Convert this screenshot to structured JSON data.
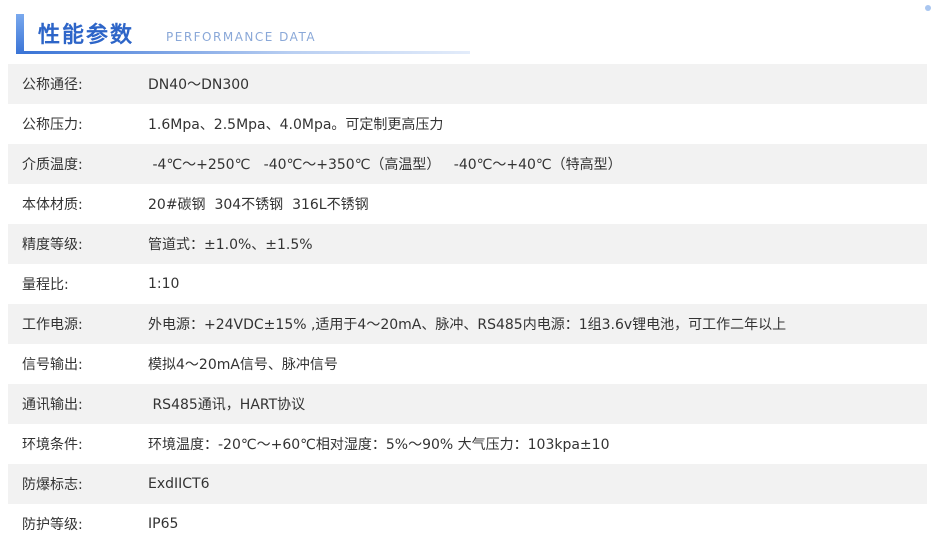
{
  "header": {
    "title": "性能参数",
    "subtitle": "PERFORMANCE DATA"
  },
  "rows": [
    {
      "label": "公称通径:",
      "value": "DN40～DN300"
    },
    {
      "label": "公称压力:",
      "value": "1.6Mpa、2.5Mpa、4.0Mpa。可定制更高压力"
    },
    {
      "label": "介质温度:",
      "value": " -4℃～+250℃   -40℃～+350℃（高温型）   -40℃～+40℃（特高型）"
    },
    {
      "label": "本体材质:",
      "value": "20#碳钢  304不锈钢  316L不锈钢"
    },
    {
      "label": "精度等级:",
      "value": "管道式：±1.0%、±1.5%"
    },
    {
      "label": "量程比:",
      "value": "1:10"
    },
    {
      "label": "工作电源:",
      "value": "外电源：+24VDC±15% ,适用于4～20mA、脉冲、RS485内电源：1组3.6v锂电池，可工作二年以上"
    },
    {
      "label": "信号输出:",
      "value": "模拟4～20mA信号、脉冲信号"
    },
    {
      "label": "通讯输出:",
      "value": " RS485通讯，HART协议"
    },
    {
      "label": "环境条件:",
      "value": "环境温度：-20℃～+60℃相对湿度：5%～90% 大气压力：103kpa±10"
    },
    {
      "label": "防爆标志:",
      "value": "ExdIICT6"
    },
    {
      "label": "防护等级:",
      "value": "IP65"
    }
  ]
}
